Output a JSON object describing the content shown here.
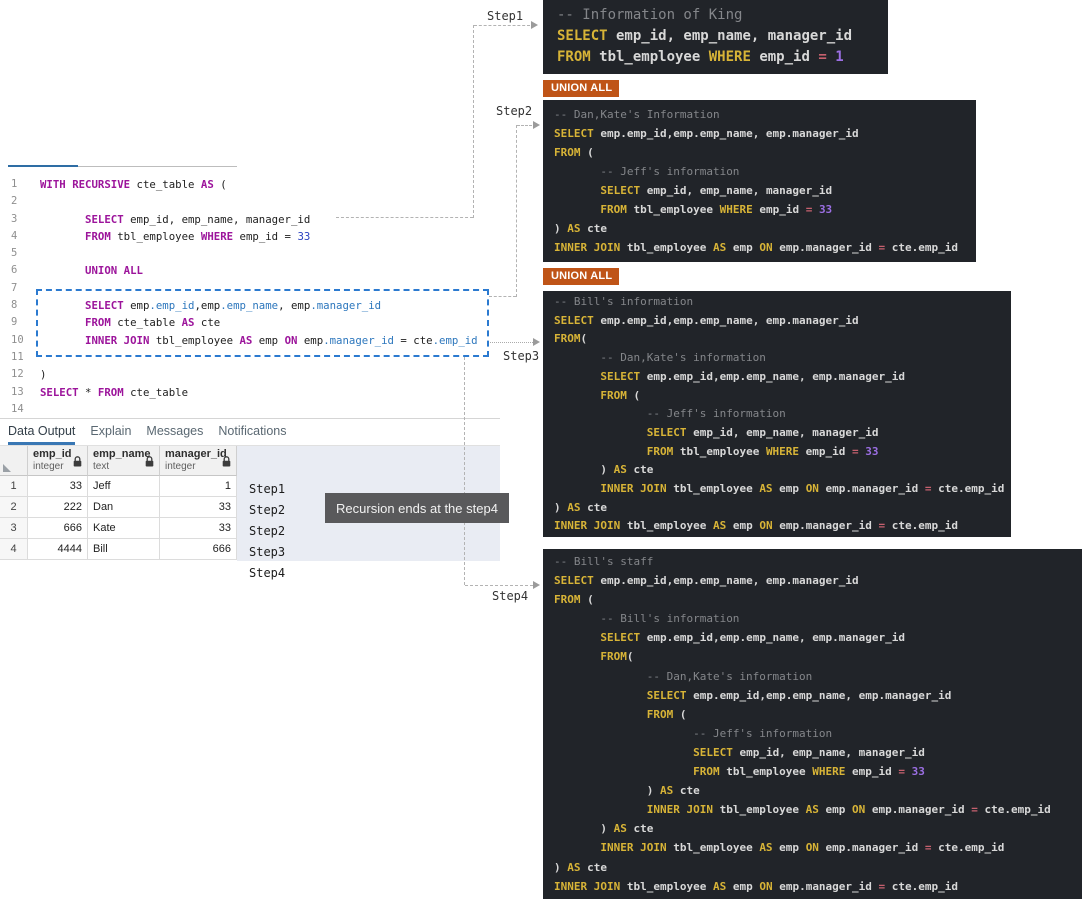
{
  "editor": {
    "lines": [
      {
        "n": "1",
        "s": [
          [
            "k",
            "WITH"
          ],
          [
            "t",
            " "
          ],
          [
            "k",
            "RECURSIVE"
          ],
          [
            "t",
            " cte_table "
          ],
          [
            "k",
            "AS"
          ],
          [
            "t",
            " ("
          ]
        ]
      },
      {
        "n": "2",
        "s": []
      },
      {
        "n": "3",
        "s": [
          [
            "t",
            "\t"
          ],
          [
            "k",
            "SELECT"
          ],
          [
            "t",
            " emp_id, emp_name, manager_id"
          ]
        ]
      },
      {
        "n": "4",
        "s": [
          [
            "t",
            "\t"
          ],
          [
            "k",
            "FROM"
          ],
          [
            "t",
            " tbl_employee "
          ],
          [
            "k",
            "WHERE"
          ],
          [
            "t",
            " emp_id = "
          ],
          [
            "n",
            "33"
          ]
        ]
      },
      {
        "n": "5",
        "s": []
      },
      {
        "n": "6",
        "s": [
          [
            "t",
            "\t"
          ],
          [
            "k",
            "UNION ALL"
          ]
        ]
      },
      {
        "n": "7",
        "s": []
      },
      {
        "n": "8",
        "s": [
          [
            "t",
            "\t"
          ],
          [
            "k",
            "SELECT"
          ],
          [
            "t",
            " emp"
          ],
          [
            "p",
            ".emp_id"
          ],
          [
            "t",
            ",emp"
          ],
          [
            "p",
            ".emp_name"
          ],
          [
            "t",
            ", emp"
          ],
          [
            "p",
            ".manager_id"
          ]
        ]
      },
      {
        "n": "9",
        "s": [
          [
            "t",
            "\t"
          ],
          [
            "k",
            "FROM"
          ],
          [
            "t",
            " cte_table "
          ],
          [
            "k",
            "AS"
          ],
          [
            "t",
            " cte"
          ]
        ]
      },
      {
        "n": "10",
        "s": [
          [
            "t",
            "\t"
          ],
          [
            "k",
            "INNER JOIN"
          ],
          [
            "t",
            " tbl_employee "
          ],
          [
            "k",
            "AS"
          ],
          [
            "t",
            " emp "
          ],
          [
            "k",
            "ON"
          ],
          [
            "t",
            " emp"
          ],
          [
            "p",
            ".manager_id"
          ],
          [
            "t",
            " = cte"
          ],
          [
            "p",
            ".emp_id"
          ]
        ]
      },
      {
        "n": "11",
        "s": []
      },
      {
        "n": "12",
        "s": [
          [
            "t",
            ")"
          ]
        ]
      },
      {
        "n": "13",
        "s": [
          [
            "k",
            "SELECT"
          ],
          [
            "t",
            " * "
          ],
          [
            "k",
            "FROM"
          ],
          [
            "t",
            " cte_table"
          ]
        ]
      },
      {
        "n": "14",
        "s": []
      }
    ]
  },
  "results": {
    "tabs": [
      {
        "label": "Data Output",
        "active": true
      },
      {
        "label": "Explain",
        "active": false
      },
      {
        "label": "Messages",
        "active": false
      },
      {
        "label": "Notifications",
        "active": false
      }
    ],
    "columns": [
      {
        "name": "emp_id",
        "type": "integer"
      },
      {
        "name": "emp_name",
        "type": "text"
      },
      {
        "name": "manager_id",
        "type": "integer"
      }
    ],
    "rows": [
      {
        "num": "1",
        "emp_id": "33",
        "emp_name": "Jeff",
        "manager_id": "1"
      },
      {
        "num": "2",
        "emp_id": "222",
        "emp_name": "Dan",
        "manager_id": "33"
      },
      {
        "num": "3",
        "emp_id": "666",
        "emp_name": "Kate",
        "manager_id": "33"
      },
      {
        "num": "4",
        "emp_id": "4444",
        "emp_name": "Bill",
        "manager_id": "666"
      }
    ],
    "step_labels": [
      "Step1",
      "Step2",
      "Step2",
      "Step3",
      "Step4"
    ]
  },
  "tooltip": {
    "text": "Recursion ends at the step4"
  },
  "union_badge": {
    "label": "UNION ALL"
  },
  "connectors": {
    "step1": "Step1",
    "step2": "Step2",
    "step3": "Step3",
    "step4": "Step4"
  },
  "code_blocks": [
    {
      "name": "b1",
      "lines": [
        [
          [
            "c",
            "-- Information of King"
          ]
        ],
        [
          [
            "k",
            "SELECT"
          ],
          [
            "t",
            " emp_id, emp_name, manager_id"
          ]
        ],
        [
          [
            "k",
            "FROM"
          ],
          [
            "t",
            " tbl_employee "
          ],
          [
            "k",
            "WHERE"
          ],
          [
            "t",
            " emp_id "
          ],
          [
            "o",
            "="
          ],
          [
            "t",
            " "
          ],
          [
            "n",
            "1"
          ]
        ]
      ]
    },
    {
      "name": "b2",
      "lines": [
        [
          [
            "c",
            "-- Dan,Kate's Information"
          ]
        ],
        [
          [
            "k",
            "SELECT"
          ],
          [
            "t",
            " emp.emp_id,emp.emp_name, emp.manager_id"
          ]
        ],
        [
          [
            "k",
            "FROM"
          ],
          [
            "t",
            " ("
          ]
        ],
        [
          [
            "c",
            "\t-- Jeff's information"
          ]
        ],
        [
          [
            "t",
            "\t"
          ],
          [
            "k",
            "SELECT"
          ],
          [
            "t",
            " emp_id, emp_name, manager_id"
          ]
        ],
        [
          [
            "t",
            "\t"
          ],
          [
            "k",
            "FROM"
          ],
          [
            "t",
            " tbl_employee "
          ],
          [
            "k",
            "WHERE"
          ],
          [
            "t",
            " emp_id "
          ],
          [
            "o",
            "="
          ],
          [
            "t",
            " "
          ],
          [
            "n",
            "33"
          ]
        ],
        [
          [
            "t",
            ") "
          ],
          [
            "k",
            "AS"
          ],
          [
            "t",
            " cte"
          ]
        ],
        [
          [
            "k",
            "INNER JOIN"
          ],
          [
            "t",
            " tbl_employee "
          ],
          [
            "k",
            "AS"
          ],
          [
            "t",
            " emp "
          ],
          [
            "k",
            "ON"
          ],
          [
            "t",
            " emp.manager_id "
          ],
          [
            "o",
            "="
          ],
          [
            "t",
            " cte.emp_id"
          ]
        ]
      ]
    },
    {
      "name": "b3",
      "lines": [
        [
          [
            "c",
            "-- Bill's information"
          ]
        ],
        [
          [
            "k",
            "SELECT"
          ],
          [
            "t",
            " emp.emp_id,emp.emp_name, emp.manager_id"
          ]
        ],
        [
          [
            "k",
            "FROM"
          ],
          [
            "t",
            "("
          ]
        ],
        [
          [
            "c",
            "\t-- Dan,Kate's information"
          ]
        ],
        [
          [
            "t",
            "\t"
          ],
          [
            "k",
            "SELECT"
          ],
          [
            "t",
            " emp.emp_id,emp.emp_name, emp.manager_id"
          ]
        ],
        [
          [
            "t",
            "\t"
          ],
          [
            "k",
            "FROM"
          ],
          [
            "t",
            " ("
          ]
        ],
        [
          [
            "c",
            "\t\t-- Jeff's information"
          ]
        ],
        [
          [
            "t",
            "\t\t"
          ],
          [
            "k",
            "SELECT"
          ],
          [
            "t",
            " emp_id, emp_name, manager_id"
          ]
        ],
        [
          [
            "t",
            "\t\t"
          ],
          [
            "k",
            "FROM"
          ],
          [
            "t",
            " tbl_employee "
          ],
          [
            "k",
            "WHERE"
          ],
          [
            "t",
            " emp_id "
          ],
          [
            "o",
            "="
          ],
          [
            "t",
            " "
          ],
          [
            "n",
            "33"
          ]
        ],
        [
          [
            "t",
            "\t) "
          ],
          [
            "k",
            "AS"
          ],
          [
            "t",
            " cte"
          ]
        ],
        [
          [
            "t",
            "\t"
          ],
          [
            "k",
            "INNER JOIN"
          ],
          [
            "t",
            " tbl_employee "
          ],
          [
            "k",
            "AS"
          ],
          [
            "t",
            " emp "
          ],
          [
            "k",
            "ON"
          ],
          [
            "t",
            " emp.manager_id "
          ],
          [
            "o",
            "="
          ],
          [
            "t",
            " cte.emp_id"
          ]
        ],
        [
          [
            "t",
            ") "
          ],
          [
            "k",
            "AS"
          ],
          [
            "t",
            " cte"
          ]
        ],
        [
          [
            "k",
            "INNER JOIN"
          ],
          [
            "t",
            " tbl_employee "
          ],
          [
            "k",
            "AS"
          ],
          [
            "t",
            " emp "
          ],
          [
            "k",
            "ON"
          ],
          [
            "t",
            " emp.manager_id "
          ],
          [
            "o",
            "="
          ],
          [
            "t",
            " cte.emp_id"
          ]
        ]
      ]
    },
    {
      "name": "b4",
      "lines": [
        [
          [
            "c",
            "-- Bill's staff"
          ]
        ],
        [
          [
            "k",
            "SELECT"
          ],
          [
            "t",
            " emp.emp_id,emp.emp_name, emp.manager_id"
          ]
        ],
        [
          [
            "k",
            "FROM"
          ],
          [
            "t",
            " ("
          ]
        ],
        [
          [
            "c",
            "\t-- Bill's information"
          ]
        ],
        [
          [
            "t",
            "\t"
          ],
          [
            "k",
            "SELECT"
          ],
          [
            "t",
            " emp.emp_id,emp.emp_name, emp.manager_id"
          ]
        ],
        [
          [
            "t",
            "\t"
          ],
          [
            "k",
            "FROM"
          ],
          [
            "t",
            "("
          ]
        ],
        [
          [
            "c",
            "\t\t-- Dan,Kate's information"
          ]
        ],
        [
          [
            "t",
            "\t\t"
          ],
          [
            "k",
            "SELECT"
          ],
          [
            "t",
            " emp.emp_id,emp.emp_name, emp.manager_id"
          ]
        ],
        [
          [
            "t",
            "\t\t"
          ],
          [
            "k",
            "FROM"
          ],
          [
            "t",
            " ("
          ]
        ],
        [
          [
            "c",
            "\t\t\t-- Jeff's information"
          ]
        ],
        [
          [
            "t",
            "\t\t\t"
          ],
          [
            "k",
            "SELECT"
          ],
          [
            "t",
            " emp_id, emp_name, manager_id"
          ]
        ],
        [
          [
            "t",
            "\t\t\t"
          ],
          [
            "k",
            "FROM"
          ],
          [
            "t",
            " tbl_employee "
          ],
          [
            "k",
            "WHERE"
          ],
          [
            "t",
            " emp_id "
          ],
          [
            "o",
            "="
          ],
          [
            "t",
            " "
          ],
          [
            "n",
            "33"
          ]
        ],
        [
          [
            "t",
            "\t\t) "
          ],
          [
            "k",
            "AS"
          ],
          [
            "t",
            " cte"
          ]
        ],
        [
          [
            "t",
            "\t\t"
          ],
          [
            "k",
            "INNER JOIN"
          ],
          [
            "t",
            " tbl_employee "
          ],
          [
            "k",
            "AS"
          ],
          [
            "t",
            " emp "
          ],
          [
            "k",
            "ON"
          ],
          [
            "t",
            " emp.manager_id "
          ],
          [
            "o",
            "="
          ],
          [
            "t",
            " cte.emp_id"
          ]
        ],
        [
          [
            "t",
            "\t) "
          ],
          [
            "k",
            "AS"
          ],
          [
            "t",
            " cte"
          ]
        ],
        [
          [
            "t",
            "\t"
          ],
          [
            "k",
            "INNER JOIN"
          ],
          [
            "t",
            " tbl_employee "
          ],
          [
            "k",
            "AS"
          ],
          [
            "t",
            " emp "
          ],
          [
            "k",
            "ON"
          ],
          [
            "t",
            " emp.manager_id "
          ],
          [
            "o",
            "="
          ],
          [
            "t",
            " cte.emp_id"
          ]
        ],
        [
          [
            "t",
            ") "
          ],
          [
            "k",
            "AS"
          ],
          [
            "t",
            " cte"
          ]
        ],
        [
          [
            "k",
            "INNER JOIN"
          ],
          [
            "t",
            " tbl_employee "
          ],
          [
            "k",
            "AS"
          ],
          [
            "t",
            " emp "
          ],
          [
            "k",
            "ON"
          ],
          [
            "t",
            " emp.manager_id "
          ],
          [
            "o",
            "="
          ],
          [
            "t",
            " cte.emp_id"
          ]
        ]
      ]
    }
  ],
  "colors": {
    "union_badge_bg": "#bf5417",
    "dark_block_bg": "#212429",
    "keyword_dark": "#d8b437",
    "keyword_editor": "#9c149b",
    "selection_border": "#2b7ad0",
    "active_tab_underline": "#3977b4",
    "tooltip_bg": "#59595b",
    "side_area_bg": "#e9ecf3"
  }
}
